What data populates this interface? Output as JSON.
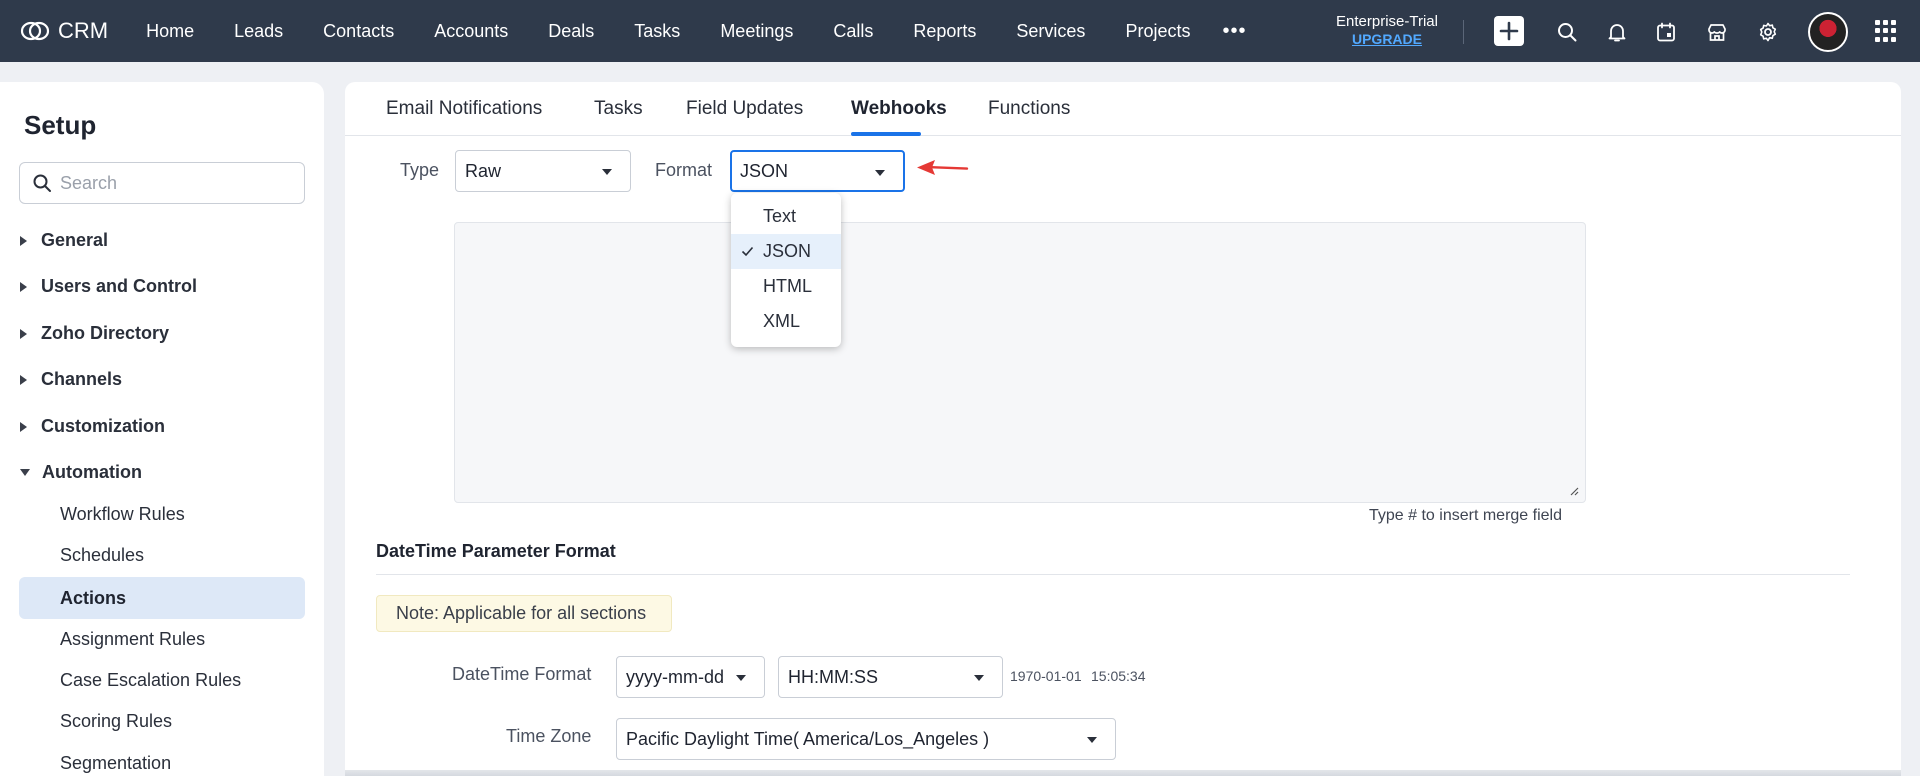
{
  "app": {
    "logo_text": "CRM"
  },
  "nav": {
    "items": [
      "Home",
      "Leads",
      "Contacts",
      "Accounts",
      "Deals",
      "Tasks",
      "Meetings",
      "Calls",
      "Reports",
      "Services",
      "Projects"
    ],
    "more": "•••"
  },
  "trial": {
    "plan": "Enterprise-Trial",
    "upgrade": "UPGRADE"
  },
  "icons": [
    "plus-icon",
    "search-icon",
    "bell-icon",
    "calendar-icon",
    "store-icon",
    "gear-icon",
    "avatar",
    "apps-grid-icon"
  ],
  "sidebar": {
    "title": "Setup",
    "search_placeholder": "Search",
    "sections": [
      "General",
      "Users and Control",
      "Zoho Directory",
      "Channels",
      "Customization",
      "Automation"
    ],
    "automation_items": [
      "Workflow Rules",
      "Schedules",
      "Actions",
      "Assignment Rules",
      "Case Escalation Rules",
      "Scoring Rules",
      "Segmentation"
    ],
    "active_item": "Actions"
  },
  "tabs": [
    "Email Notifications",
    "Tasks",
    "Field Updates",
    "Webhooks",
    "Functions"
  ],
  "active_tab": "Webhooks",
  "body": {
    "type_label": "Type",
    "type_value": "Raw",
    "format_label": "Format",
    "format_value": "JSON",
    "format_options": [
      "Text",
      "JSON",
      "HTML",
      "XML"
    ],
    "format_selected": "JSON",
    "merge_hint": "Type # to insert merge field"
  },
  "datetime": {
    "section_title": "DateTime Parameter Format",
    "note": "Note: Applicable for all sections",
    "format_label": "DateTime Format",
    "date_format": "yyyy-mm-dd",
    "time_format": "HH:MM:SS",
    "date_preview": "1970-01-01",
    "time_preview": "15:05:34",
    "timezone_label": "Time Zone",
    "timezone_value": "Pacific Daylight Time( America/Los_Angeles )"
  },
  "colors": {
    "topbar": "#2f3a4b",
    "accent": "#1a73e8",
    "active_item_bg": "#dde8f7",
    "arrow": "#e53935",
    "note_bg": "#fdf9e4"
  }
}
